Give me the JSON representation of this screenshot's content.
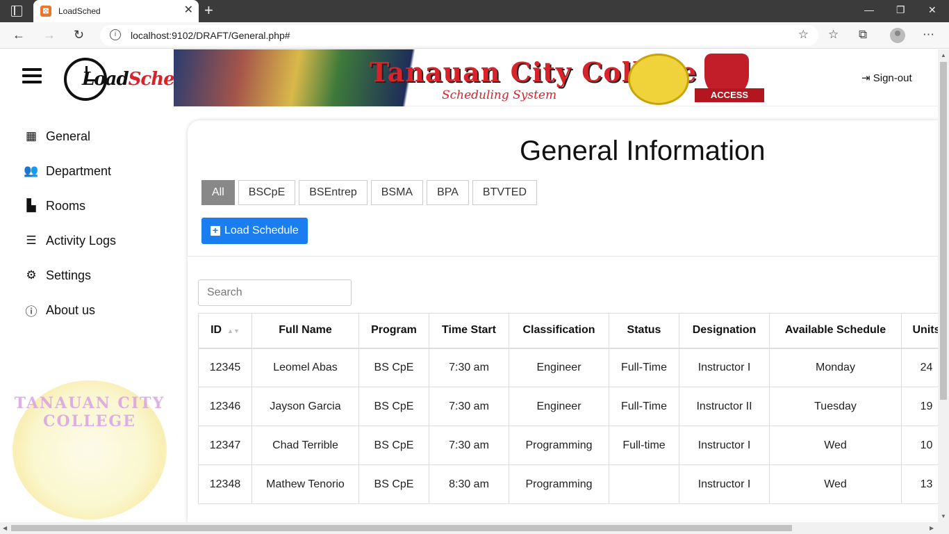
{
  "browser": {
    "tab_title": "LoadSched",
    "url": "localhost:9102/DRAFT/General.php#"
  },
  "sidebar": {
    "logo_text_a": "Load",
    "logo_text_b": "Sched",
    "items": [
      {
        "label": "General",
        "icon": "dashboard-icon"
      },
      {
        "label": "Department",
        "icon": "users-icon"
      },
      {
        "label": "Rooms",
        "icon": "door-icon"
      },
      {
        "label": "Activity Logs",
        "icon": "list-icon"
      },
      {
        "label": "Settings",
        "icon": "gears-icon"
      },
      {
        "label": "About us",
        "icon": "info-icon"
      }
    ],
    "seal_text": "TANAUAN CITY COLLEGE"
  },
  "banner": {
    "title": "Tanauan City College",
    "subtitle": "Scheduling System",
    "access_label": "ACCESS"
  },
  "header": {
    "signout_label": "Sign-out"
  },
  "main": {
    "title": "General Information",
    "filters": [
      "All",
      "BSCpE",
      "BSEntrep",
      "BSMA",
      "BPA",
      "BTVTED"
    ],
    "active_filter": "All",
    "load_button": "Load Schedule",
    "search_placeholder": "Search"
  },
  "table": {
    "columns": [
      "ID",
      "Full Name",
      "Program",
      "Time Start",
      "Classification",
      "Status",
      "Designation",
      "Available Schedule",
      "Units"
    ],
    "rows": [
      [
        "12345",
        "Leomel Abas",
        "BS CpE",
        "7:30 am",
        "Engineer",
        "Full-Time",
        "Instructor I",
        "Monday",
        "24"
      ],
      [
        "12346",
        "Jayson Garcia",
        "BS CpE",
        "7:30 am",
        "Engineer",
        "Full-Time",
        "Instructor II",
        "Tuesday",
        "19"
      ],
      [
        "12347",
        "Chad Terrible",
        "BS CpE",
        "7:30 am",
        "Programming",
        "Full-time",
        "Instructor I",
        "Wed",
        "10"
      ],
      [
        "12348",
        "Mathew Tenorio",
        "BS CpE",
        "8:30 am",
        "Programming",
        "",
        "Instructor I",
        "Wed",
        "13"
      ]
    ]
  },
  "colors": {
    "primary_button": "#1a7ef0",
    "active_filter": "#888888",
    "banner_red": "#d8232a"
  }
}
